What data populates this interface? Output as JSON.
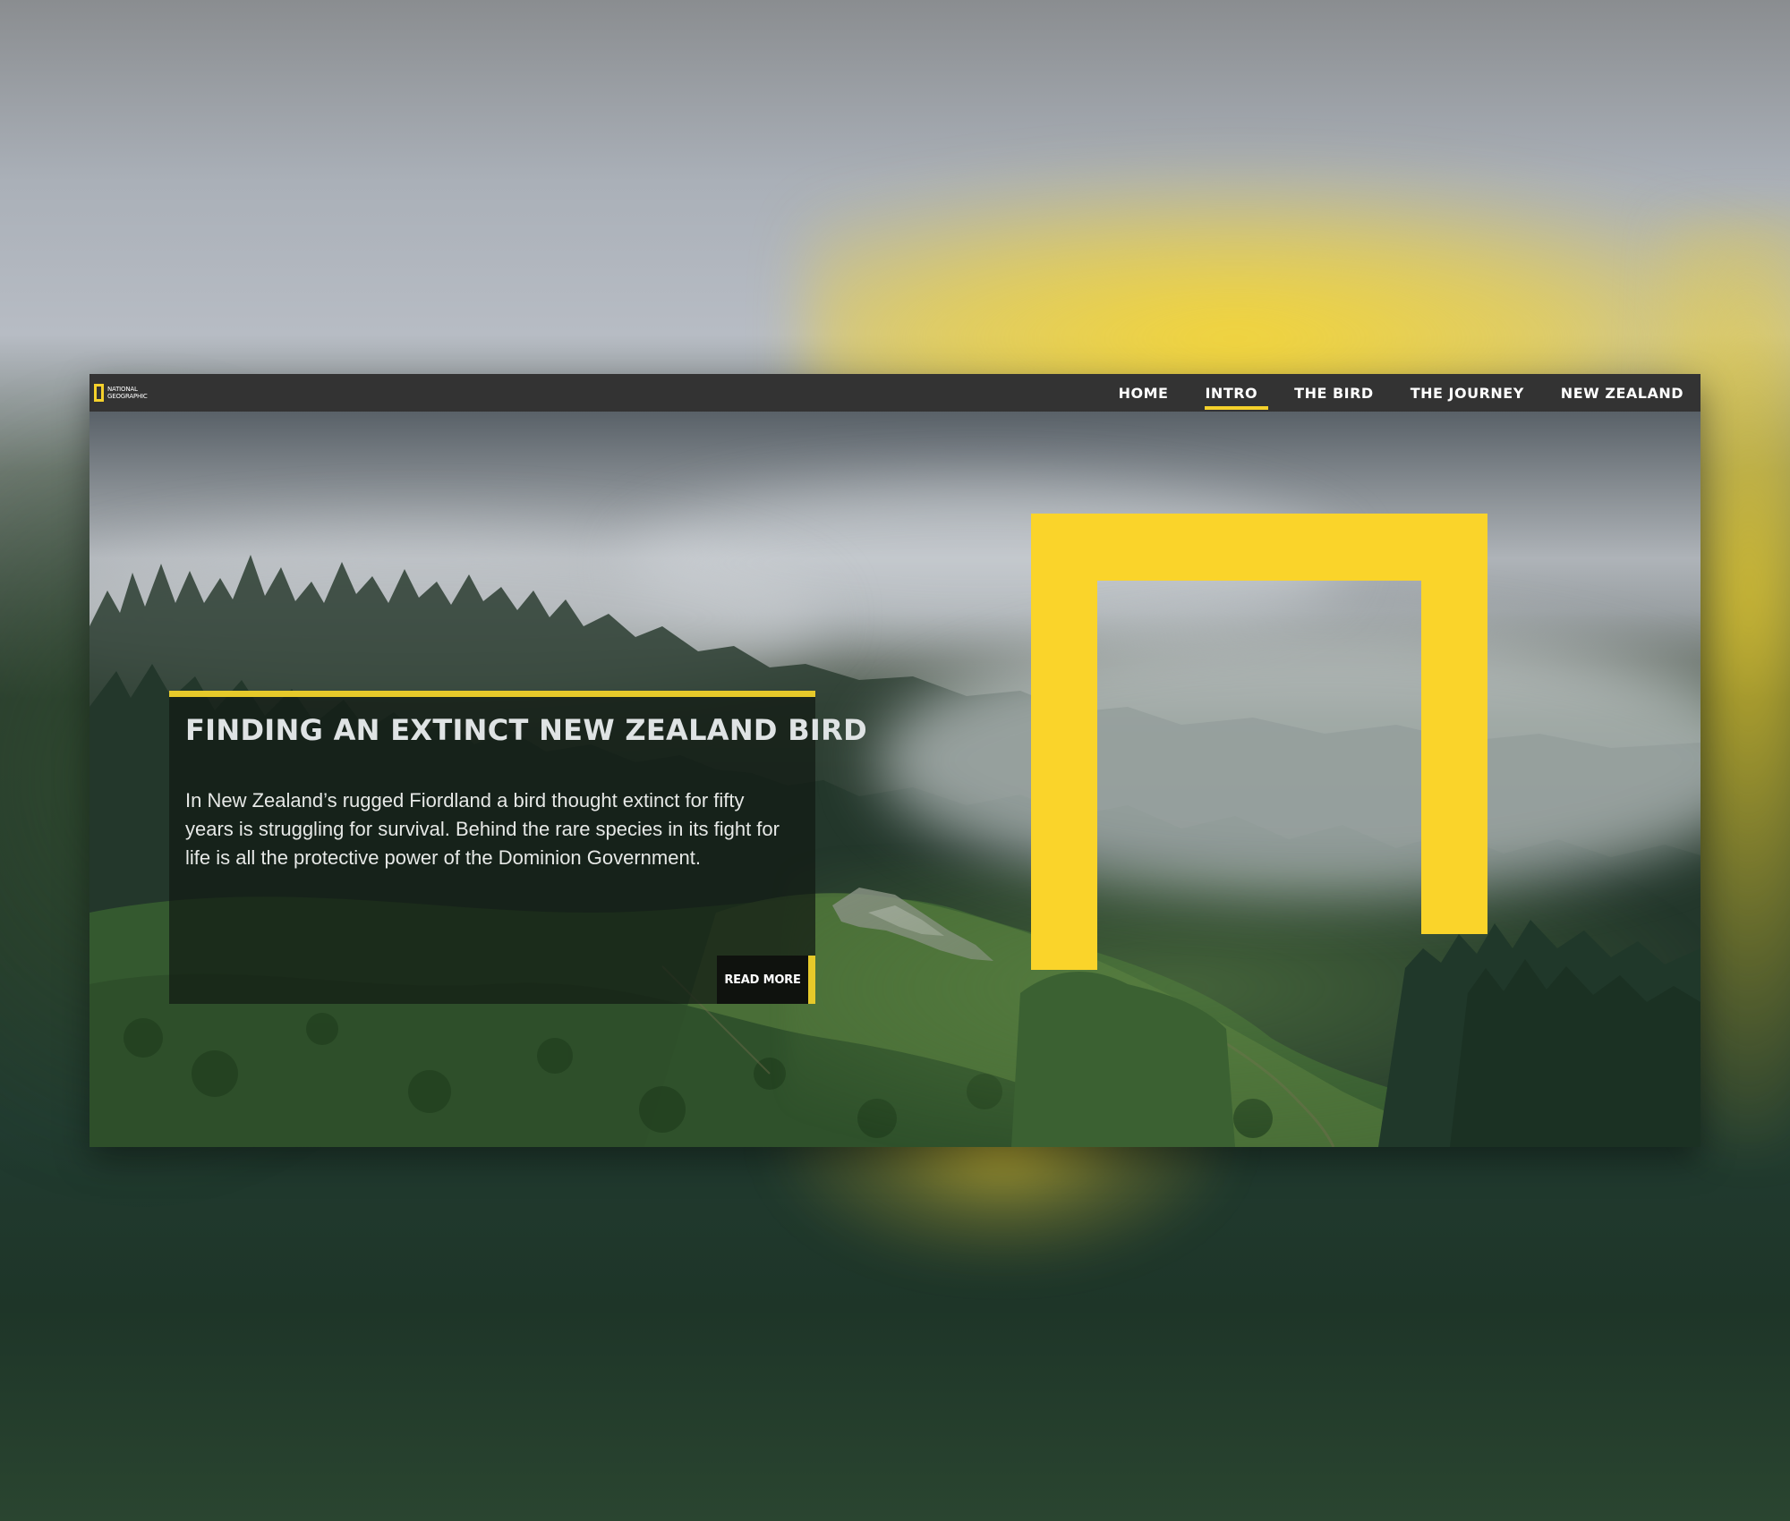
{
  "brand": {
    "logo_line1": "NATIONAL",
    "logo_line2": "GEOGRAPHIC",
    "accent_color": "#FAD42A"
  },
  "nav": {
    "items": [
      {
        "label": "HOME",
        "active": false
      },
      {
        "label": "INTRO",
        "active": true
      },
      {
        "label": "THE BIRD",
        "active": false
      },
      {
        "label": "THE JOURNEY",
        "active": false
      },
      {
        "label": "NEW ZEALAND",
        "active": false
      }
    ]
  },
  "hero": {
    "title": "FINDING AN EXTINCT NEW ZEALAND BIRD",
    "body": "In New Zealand’s rugged Fiordland a bird thought extinct for fifty years is struggling for survival. Behind the rare species in its fight for life is all the protective power of the Dominion Government.",
    "read_more_label": "READ MORE"
  }
}
